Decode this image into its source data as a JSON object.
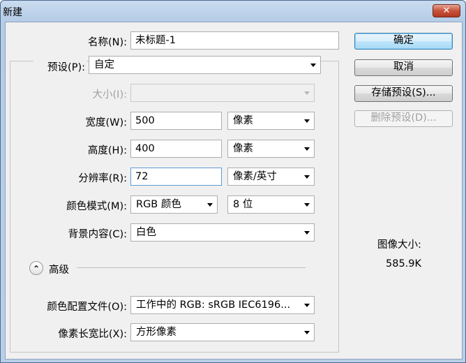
{
  "window": {
    "title": "新建",
    "close_glyph": "✕"
  },
  "form": {
    "name_label": "名称(N):",
    "name_value": "未标题-1",
    "preset_label": "预设(P):",
    "preset_value": "自定",
    "size_label": "大小(I):",
    "size_value": "",
    "width_label": "宽度(W):",
    "width_value": "500",
    "width_unit": "像素",
    "height_label": "高度(H):",
    "height_value": "400",
    "height_unit": "像素",
    "resolution_label": "分辨率(R):",
    "resolution_value": "72",
    "resolution_unit": "像素/英寸",
    "color_mode_label": "颜色模式(M):",
    "color_mode_value": "RGB 颜色",
    "bit_depth_value": "8 位",
    "background_label": "背景内容(C):",
    "background_value": "白色",
    "advanced_label": "高级",
    "advanced_toggle_glyph": "⌃",
    "color_profile_label": "颜色配置文件(O):",
    "color_profile_value": "工作中的 RGB: sRGB IEC6196...",
    "pixel_aspect_label": "像素长宽比(X):",
    "pixel_aspect_value": "方形像素"
  },
  "buttons": {
    "ok": "确定",
    "cancel": "取消",
    "save_preset": "存储预设(S)...",
    "delete_preset": "删除预设(D)..."
  },
  "image_size": {
    "label": "图像大小:",
    "value": "585.9K"
  },
  "colors": {
    "title_bar": "#b9cfe9",
    "close_button": "#c7523a",
    "dialog_bg": "#f0f0f0",
    "default_button": "#bee6fd"
  }
}
